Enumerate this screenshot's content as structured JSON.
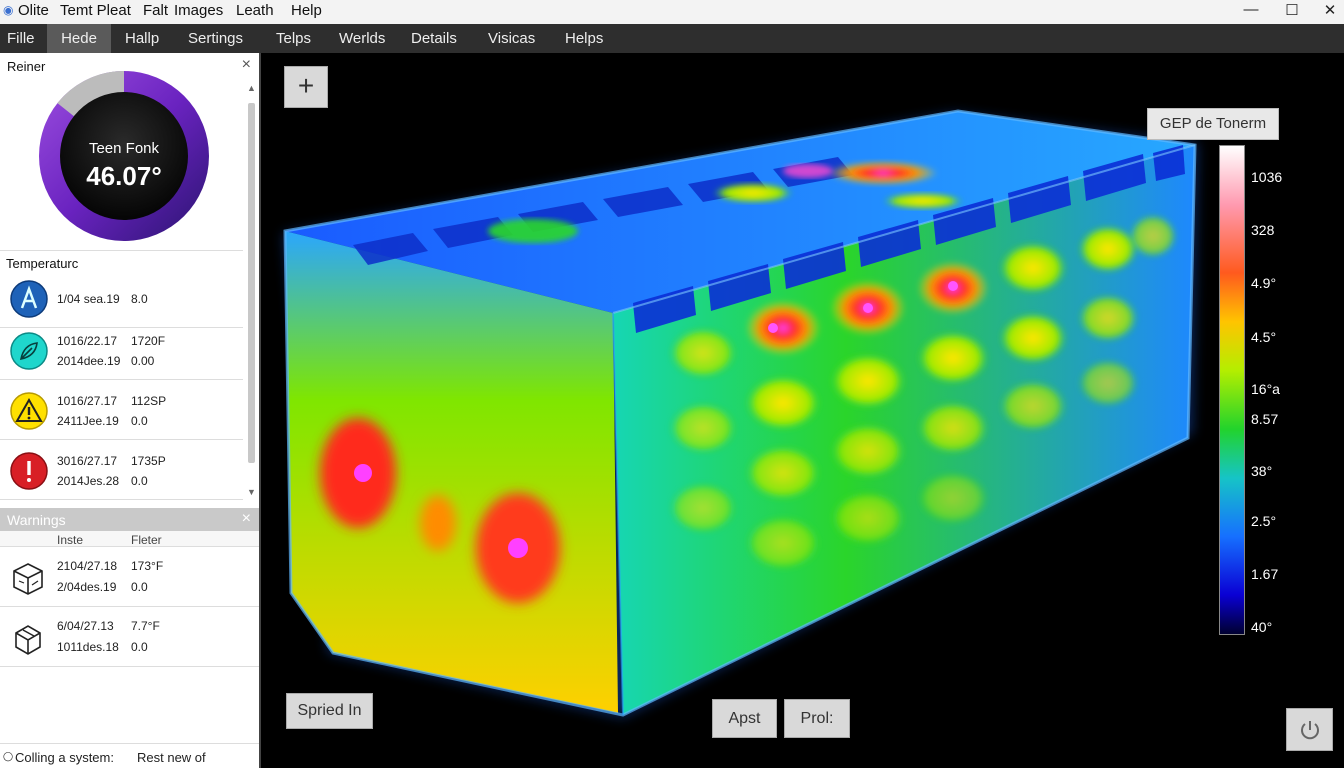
{
  "titlebar": {
    "items": [
      "Olite",
      "Temt Pleat",
      "Falt",
      "Images",
      "Leath",
      "Help"
    ],
    "minimize": "—",
    "maximize": "☐",
    "close": "✕"
  },
  "menubar": {
    "items": [
      "Fille",
      "Hede",
      "Hallp",
      "Sertings",
      "Telps",
      "Werlds",
      "Details",
      "Visicas",
      "Helps"
    ],
    "active_index": 1
  },
  "left_panel": {
    "title": "Reiner",
    "close": "×",
    "gauge": {
      "label": "Teen Fonk",
      "value": "46.07°",
      "level": 0.97
    },
    "temperature_section": {
      "title": "Temperaturc",
      "rows": [
        {
          "icon": "blue-a-icon",
          "line1": "1/04 sea.19",
          "val1": "8.0",
          "line2": "",
          "val2": ""
        },
        {
          "icon": "cyan-leaf-icon",
          "line1": "1016/22.17",
          "val1": "1720F",
          "line2": "2014dee.19",
          "val2": "0.00"
        },
        {
          "icon": "warning-icon",
          "line1": "1016/27.17",
          "val1": "112SP",
          "line2": "2411Jee.19",
          "val2": "0.0"
        },
        {
          "icon": "error-icon",
          "line1": "3016/27.17",
          "val1": "1735P",
          "line2": "2014Jes.28",
          "val2": "0.0"
        }
      ]
    },
    "warnings": {
      "title": "Warnings",
      "close": "×",
      "col1": "Inste",
      "col2": "Fleter",
      "rows": [
        {
          "icon": "cube-icon",
          "line1": "2104/27.18",
          "val1": "173°F",
          "line2": "2/04des.19",
          "val2": "0.0"
        },
        {
          "icon": "box-icon",
          "line1": "6/04/27.13",
          "val1": "7.7°F",
          "line2": "1011des.18",
          "val2": "0.0"
        }
      ]
    },
    "status": {
      "left": "Colling a system:",
      "right": "Rest new of"
    }
  },
  "viewport": {
    "add_button": "+",
    "legend_title": "GEP de Tonerm",
    "ticks": [
      "1036",
      "328",
      "4.9°",
      "4.5°",
      "16°a",
      "8.57",
      "38°",
      "2.5°",
      "1.67",
      "40°"
    ],
    "spried_button": "Spried In",
    "apst_button": "Apst",
    "prol_button": "Prol:",
    "power_icon": "power-icon"
  },
  "colors": {
    "gauge_ring": "#6f2bbd",
    "menubar": "#2e2e2e",
    "active_menu": "#5a5a5a"
  }
}
